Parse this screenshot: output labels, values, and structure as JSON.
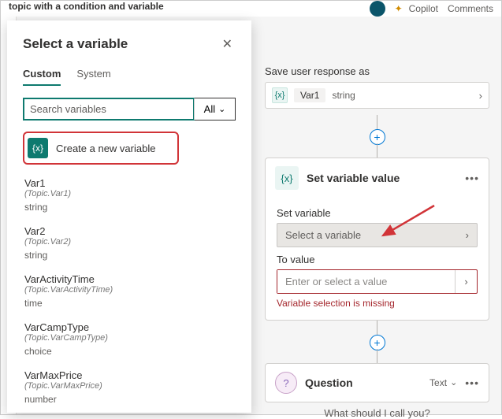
{
  "header": {
    "breadcrumb": "topic with a condition and variable",
    "copilot": "Copilot",
    "comments": "Comments"
  },
  "panel": {
    "title": "Select a variable",
    "tabs": {
      "custom": "Custom",
      "system": "System"
    },
    "search_placeholder": "Search variables",
    "all_label": "All",
    "create_label": "Create a new variable",
    "vars": [
      {
        "name": "Var1",
        "path": "(Topic.Var1)",
        "type": "string"
      },
      {
        "name": "Var2",
        "path": "(Topic.Var2)",
        "type": "string"
      },
      {
        "name": "VarActivityTime",
        "path": "(Topic.VarActivityTime)",
        "type": "time"
      },
      {
        "name": "VarCampType",
        "path": "(Topic.VarCampType)",
        "type": "choice"
      },
      {
        "name": "VarMaxPrice",
        "path": "(Topic.VarMaxPrice)",
        "type": "number"
      }
    ]
  },
  "flow": {
    "save_label": "Save user response as",
    "save_var": "Var1",
    "save_type": "string",
    "node_title": "Set variable value",
    "set_label": "Set variable",
    "select_placeholder": "Select a variable",
    "to_label": "To value",
    "to_placeholder": "Enter or select a value",
    "error": "Variable selection is missing",
    "question_title": "Question",
    "question_type": "Text",
    "question_prompt": "What should I call you?"
  },
  "glyphs": {
    "var": "{x}",
    "q": "?"
  }
}
